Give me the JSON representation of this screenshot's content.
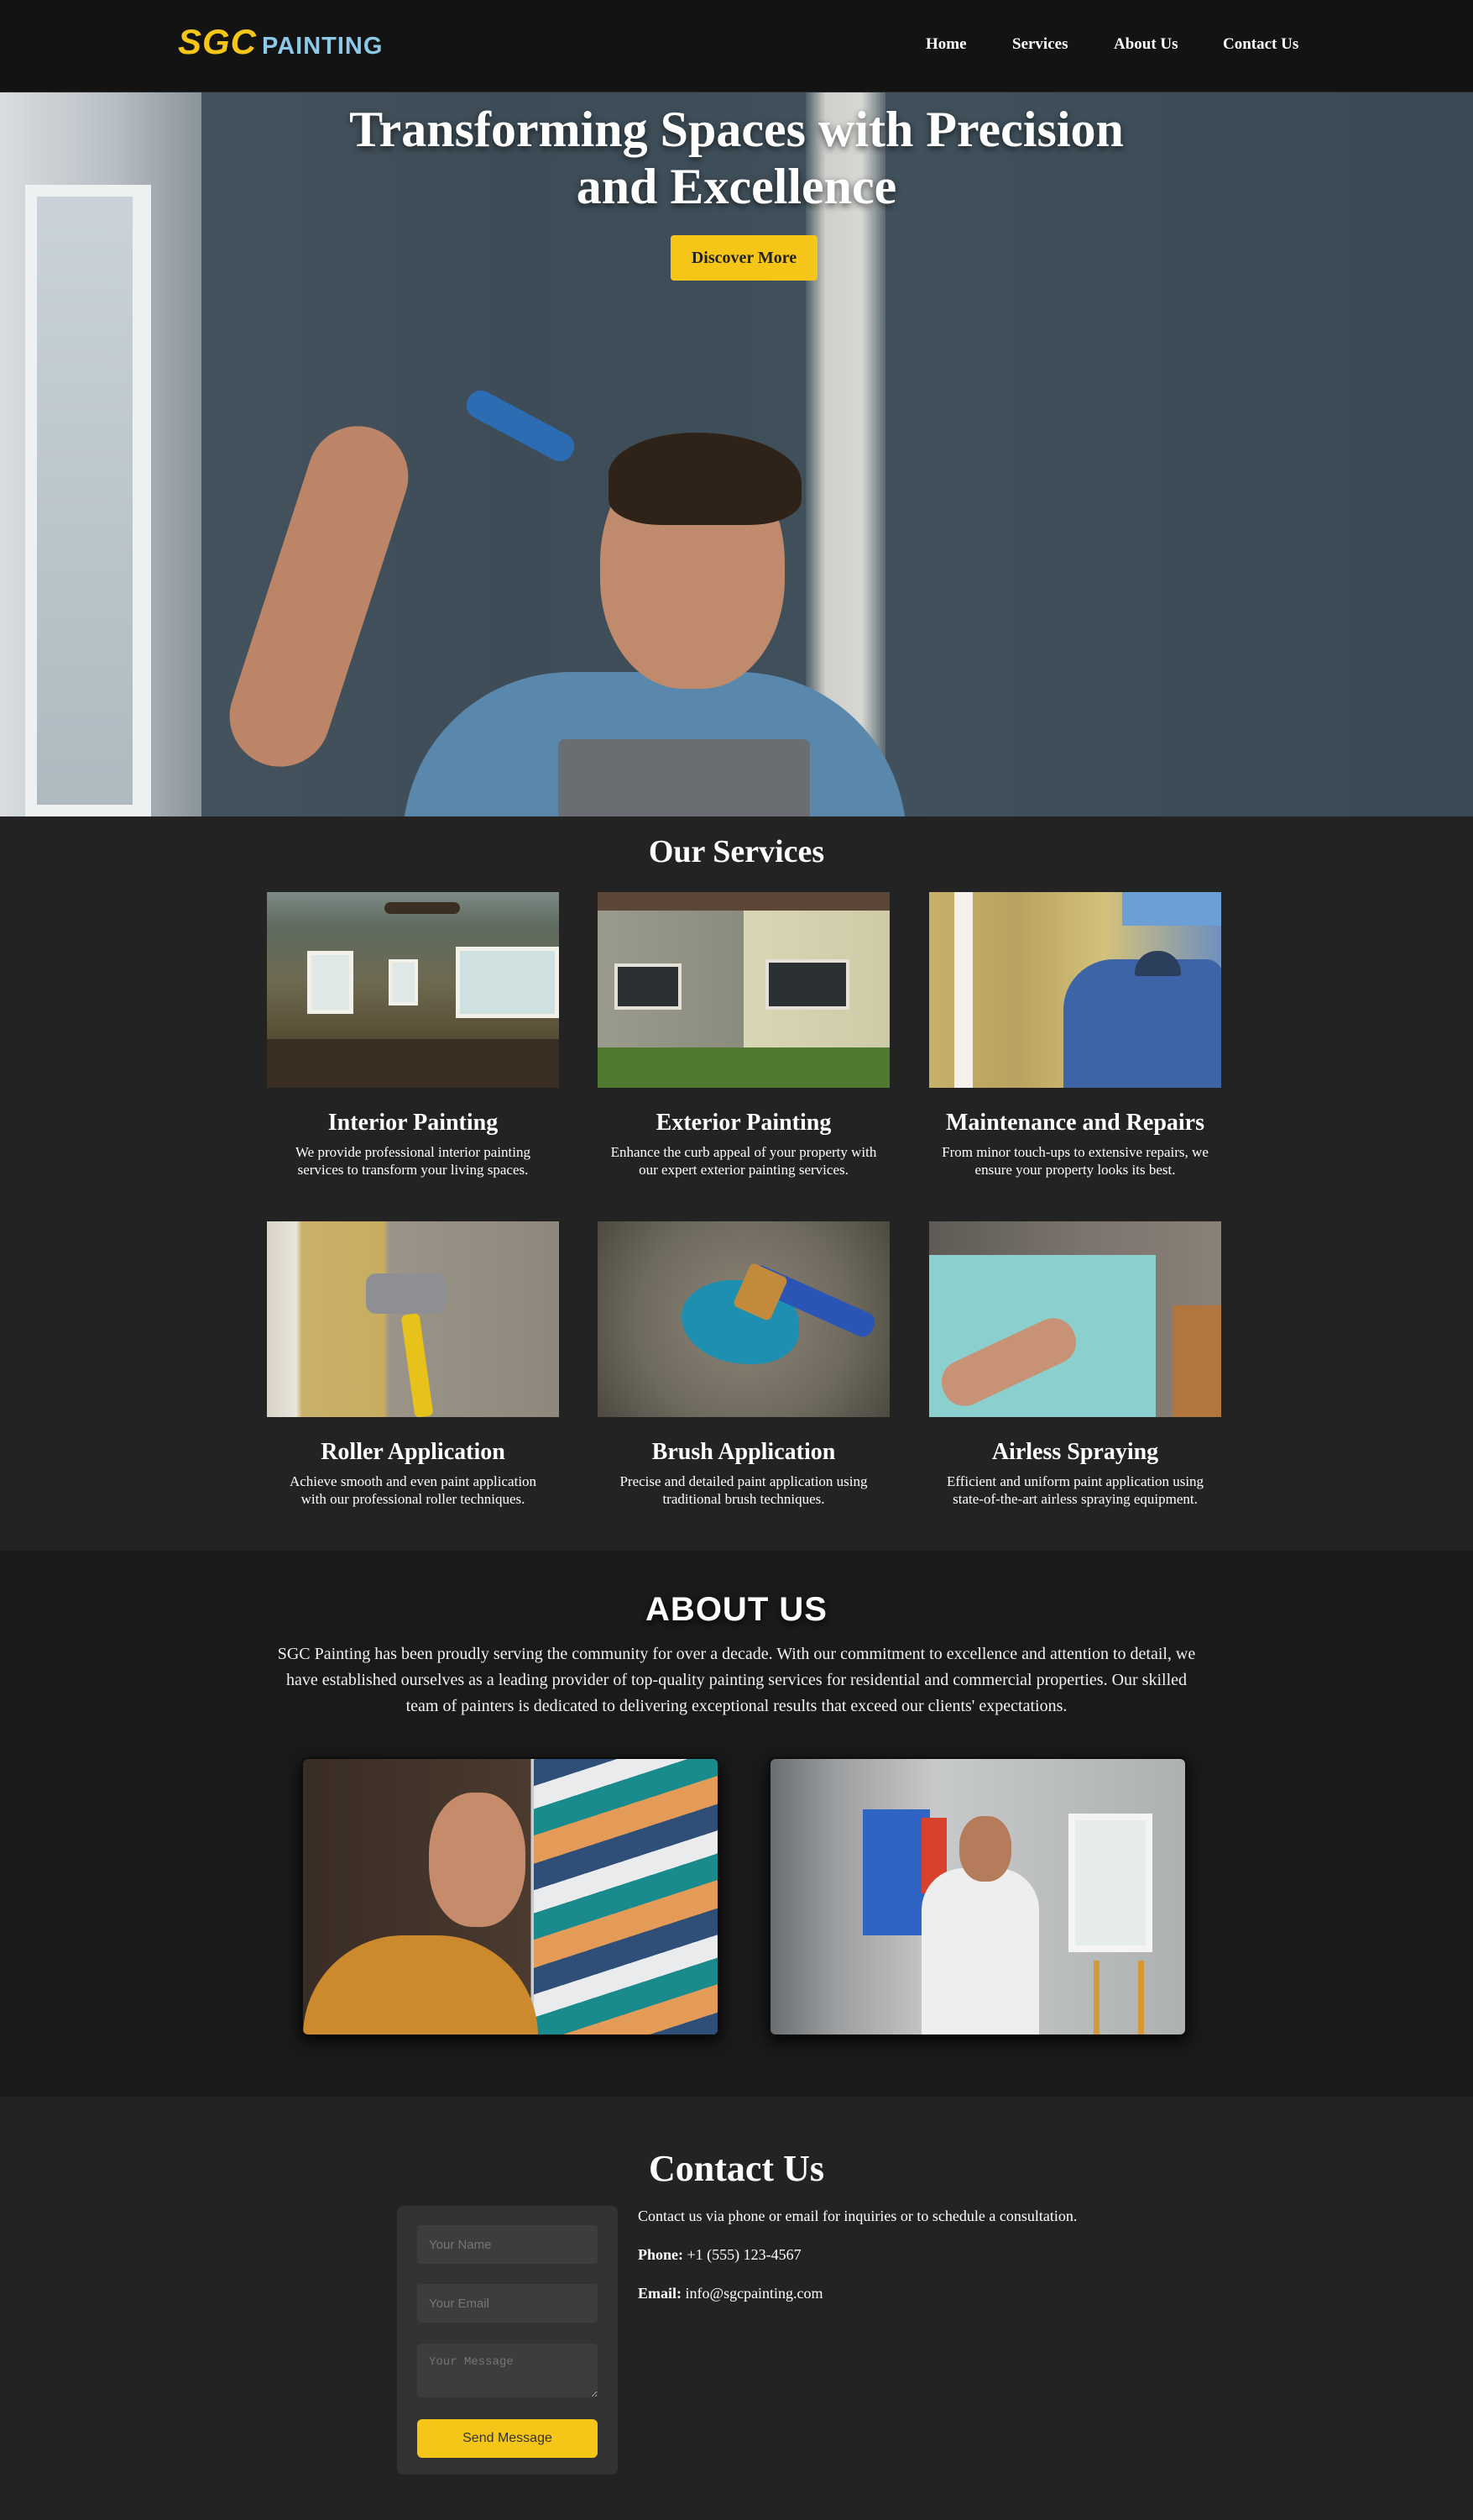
{
  "nav": {
    "logo_primary": "SGC",
    "logo_secondary": "PAINTING",
    "links": [
      "Home",
      "Services",
      "About Us",
      "Contact Us"
    ]
  },
  "hero": {
    "title_line1": "Transforming Spaces with Precision",
    "title_line2": "and Excellence",
    "button": "Discover More"
  },
  "services": {
    "title": "Our Services",
    "items": [
      {
        "title": "Interior Painting",
        "desc": "We provide professional interior painting services to transform your living spaces."
      },
      {
        "title": "Exterior Painting",
        "desc": "Enhance the curb appeal of your property with our expert exterior painting services."
      },
      {
        "title": "Maintenance and Repairs",
        "desc": "From minor touch-ups to extensive repairs, we ensure your property looks its best."
      },
      {
        "title": "Roller Application",
        "desc": "Achieve smooth and even paint application with our professional roller techniques."
      },
      {
        "title": "Brush Application",
        "desc": "Precise and detailed paint application using traditional brush techniques."
      },
      {
        "title": "Airless Spraying",
        "desc": "Efficient and uniform paint application using state-of-the-art airless spraying equipment."
      }
    ]
  },
  "about": {
    "title": "ABOUT US",
    "text": "SGC Painting has been proudly serving the community for over a decade. With our commitment to excellence and attention to detail, we have established ourselves as a leading provider of top-quality painting services for residential and commercial properties. Our skilled team of painters is dedicated to delivering exceptional results that exceed our clients' expectations."
  },
  "contact": {
    "title": "Contact Us",
    "name_placeholder": "Your Name",
    "email_placeholder": "Your Email",
    "message_placeholder": "Your Message",
    "send_label": "Send Message",
    "intro": "Contact us via phone or email for inquiries or to schedule a consultation.",
    "phone_label": "Phone:",
    "phone": "+1 (555) 123-4567",
    "email_label": "Email:",
    "email": "info@sgcpainting.com"
  },
  "colors": {
    "accent": "#f5c518",
    "logo_secondary": "#8ec8e8",
    "background": "#1a1a1a"
  }
}
